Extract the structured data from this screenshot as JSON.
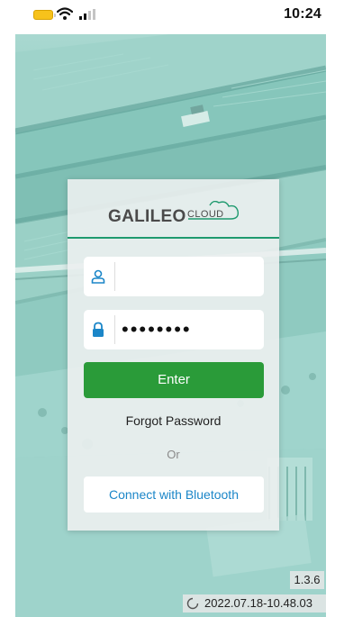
{
  "status_bar": {
    "time": "10:24",
    "battery_color": "#f7c21b"
  },
  "brand": {
    "name": "GALILEO",
    "suffix": "CLOUD",
    "accent_color": "#1f9a6f"
  },
  "login": {
    "username": {
      "icon": "user-icon",
      "value": ""
    },
    "password": {
      "icon": "lock-icon",
      "value": "••••••••"
    },
    "enter_label": "Enter",
    "enter_color": "#2a9b39",
    "forgot_label": "Forgot Password",
    "or_label": "Or",
    "bluetooth_label": "Connect with Bluetooth"
  },
  "footer": {
    "version": "1.3.6",
    "build": "2022.07.18-10.48.03"
  }
}
